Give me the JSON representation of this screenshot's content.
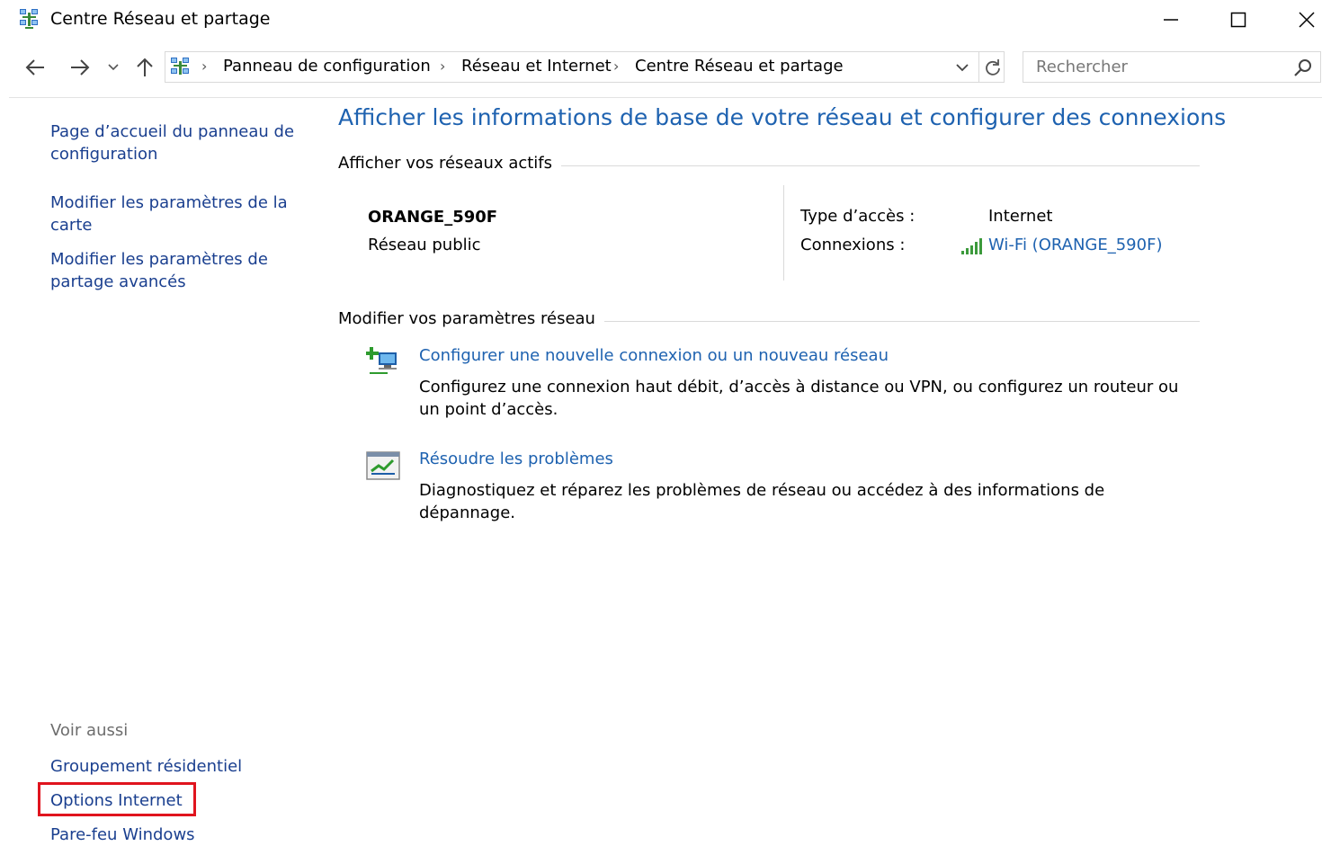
{
  "window": {
    "title": "Centre Réseau et partage",
    "minimize": "—",
    "maximize": "☐",
    "close": "✕"
  },
  "nav": {
    "breadcrumbs": [
      "Panneau de configuration",
      "Réseau et Internet",
      "Centre Réseau et partage"
    ],
    "separator": "›",
    "search_placeholder": "Rechercher"
  },
  "left_pane": {
    "links": [
      "Page d’accueil du panneau de configuration",
      "Modifier les paramètres de la carte",
      "Modifier les paramètres de partage avancés"
    ],
    "see_also_title": "Voir aussi",
    "see_also_links": [
      "Groupement résidentiel",
      "Options Internet",
      "Pare-feu Windows"
    ]
  },
  "main": {
    "heading": "Afficher les informations de base de votre réseau et configurer des connexions",
    "active_networks_title": "Afficher vos réseaux actifs",
    "network": {
      "name": "ORANGE_590F",
      "category": "Réseau public",
      "access_type_label": "Type d’accès :",
      "access_type_value": "Internet",
      "connections_label": "Connexions :",
      "connections_value": "Wi-Fi (ORANGE_590F)"
    },
    "change_settings_title": "Modifier vos paramètres réseau",
    "tasks": [
      {
        "link": "Configurer une nouvelle connexion ou un nouveau réseau",
        "description": "Configurez une connexion haut débit, d’accès à distance ou VPN, ou configurez un routeur ou un point d’accès."
      },
      {
        "link": "Résoudre les problèmes",
        "description": "Diagnostiquez et réparez les problèmes de réseau ou accédez à des informations de dépannage."
      }
    ]
  },
  "colors": {
    "link": "#1e62b0",
    "left_link": "#1a3f8f",
    "highlight": "#e0141e"
  }
}
